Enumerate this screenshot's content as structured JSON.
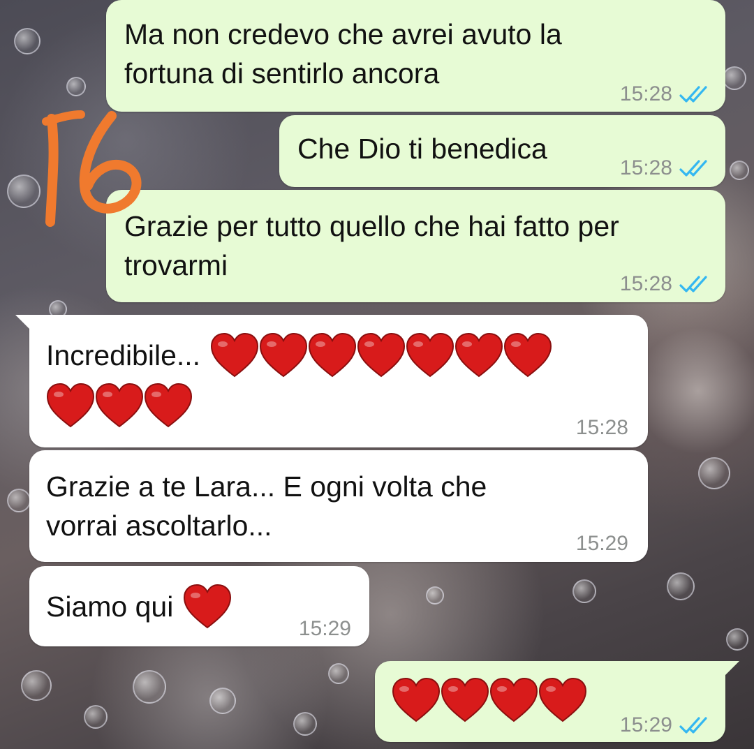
{
  "chat": {
    "messages": [
      {
        "direction": "outgoing",
        "text_lines": [
          "Ma non credevo che avrei avuto la",
          "fortuna di sentirlo ancora"
        ],
        "time": "15:28",
        "status": "read"
      },
      {
        "direction": "outgoing",
        "text_lines": [
          "Che Dio ti benedica"
        ],
        "time": "15:28",
        "status": "read"
      },
      {
        "direction": "outgoing",
        "text_lines": [
          "Grazie per tutto quello che hai fatto per",
          "trovarmi"
        ],
        "time": "15:28",
        "status": "read"
      },
      {
        "direction": "incoming",
        "text_lines": [
          "Incredibile..."
        ],
        "emoji": "red-heart",
        "emoji_count": 10,
        "time": "15:28"
      },
      {
        "direction": "incoming",
        "text_lines": [
          "Grazie a te Lara... E ogni volta che",
          "vorrai ascoltarlo..."
        ],
        "time": "15:29"
      },
      {
        "direction": "incoming",
        "text_lines": [
          "Siamo qui"
        ],
        "emoji": "red-heart",
        "emoji_count": 1,
        "time": "15:29"
      },
      {
        "direction": "outgoing",
        "text_lines": [],
        "emoji": "red-heart",
        "emoji_count": 4,
        "time": "15:29",
        "status": "read"
      }
    ]
  },
  "overlay": {
    "handwritten_number": "16",
    "color": "#f07a2e"
  },
  "colors": {
    "outgoing_bubble": "#e7fbd5",
    "incoming_bubble": "#ffffff",
    "read_ticks": "#34b7f1",
    "timestamp": "#8c8f8e",
    "heart": "#d81b1b"
  },
  "icons": {
    "read_receipt": "double-check-icon",
    "emoji": "red-heart-icon"
  }
}
